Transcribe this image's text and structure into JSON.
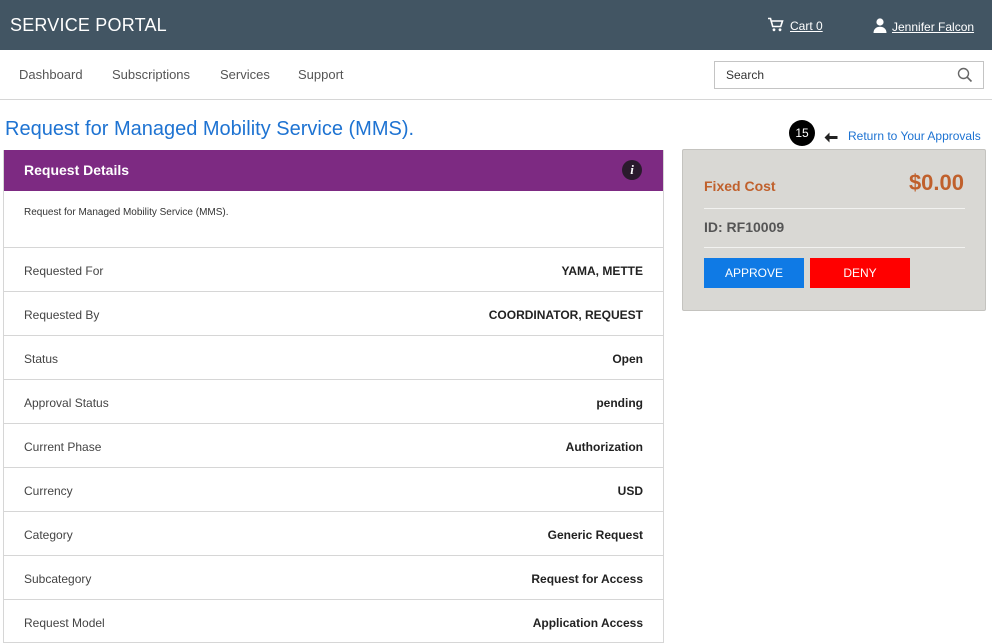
{
  "header": {
    "brand": "SERVICE PORTAL",
    "cart_label": "Cart 0",
    "user_name": "Jennifer Falcon"
  },
  "nav": {
    "items": [
      "Dashboard",
      "Subscriptions",
      "Services",
      "Support"
    ],
    "search_placeholder": "Search"
  },
  "page": {
    "title": "Request for Managed Mobility Service (MMS).",
    "badge_number": "15",
    "return_link": "Return to Your Approvals"
  },
  "details": {
    "header": "Request Details",
    "info_icon_glyph": "i",
    "description": "Request for Managed Mobility Service (MMS).",
    "rows": [
      {
        "label": "Requested For",
        "value": "YAMA, METTE"
      },
      {
        "label": "Requested By",
        "value": "COORDINATOR, REQUEST"
      },
      {
        "label": "Status",
        "value": "Open"
      },
      {
        "label": "Approval Status",
        "value": "pending"
      },
      {
        "label": "Current Phase",
        "value": "Authorization"
      },
      {
        "label": "Currency",
        "value": "USD"
      },
      {
        "label": "Category",
        "value": "Generic Request"
      },
      {
        "label": "Subcategory",
        "value": "Request for Access"
      },
      {
        "label": "Request Model",
        "value": "Application Access"
      }
    ]
  },
  "summary": {
    "fixed_cost_label": "Fixed Cost",
    "fixed_cost_value": "$0.00",
    "id_text": "ID:  RF10009",
    "approve_label": "APPROVE",
    "deny_label": "DENY"
  },
  "colors": {
    "topbar": "#425563",
    "accent_purple": "#7d2a82",
    "link_blue": "#1e73d2",
    "approve_blue": "#0f7ae5",
    "deny_red": "#ff0000",
    "cost_orange": "#c0602c"
  },
  "icons": {
    "cart": "cart-icon",
    "user": "user-icon",
    "search": "search-icon",
    "back": "arrow-left-icon",
    "info": "info-icon"
  }
}
